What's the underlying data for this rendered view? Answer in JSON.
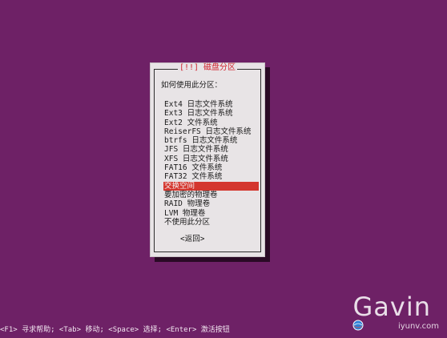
{
  "dialog": {
    "title": "[!!] 磁盘分区",
    "prompt": "如何使用此分区：",
    "options": [
      {
        "label": "Ext4 日志文件系统",
        "selected": false
      },
      {
        "label": "Ext3 日志文件系统",
        "selected": false
      },
      {
        "label": "Ext2 文件系统",
        "selected": false
      },
      {
        "label": "ReiserFS 日志文件系统",
        "selected": false
      },
      {
        "label": "btrfs 日志文件系统",
        "selected": false
      },
      {
        "label": "JFS 日志文件系统",
        "selected": false
      },
      {
        "label": "XFS 日志文件系统",
        "selected": false
      },
      {
        "label": "FAT16 文件系统",
        "selected": false
      },
      {
        "label": "FAT32 文件系统",
        "selected": false
      },
      {
        "label": "交换空间",
        "selected": true
      },
      {
        "label": "要加密的物理卷",
        "selected": false
      },
      {
        "label": "RAID 物理卷",
        "selected": false
      },
      {
        "label": "LVM 物理卷",
        "selected": false
      },
      {
        "label": "不使用此分区",
        "selected": false
      }
    ],
    "back_label": "<返回>"
  },
  "status_bar": {
    "help_text": "<F1> 寻求帮助; <Tab> 移动; <Space> 选择; <Enter> 激活按钮"
  },
  "watermark": {
    "name": "Gavin",
    "domain": "iyunv.com"
  },
  "colors": {
    "background": "#6e2166",
    "dialog_background": "#e8e4e6",
    "title_text": "#d0232f",
    "selection_highlight": "#d4362e",
    "shadow": "#2a0a25"
  }
}
